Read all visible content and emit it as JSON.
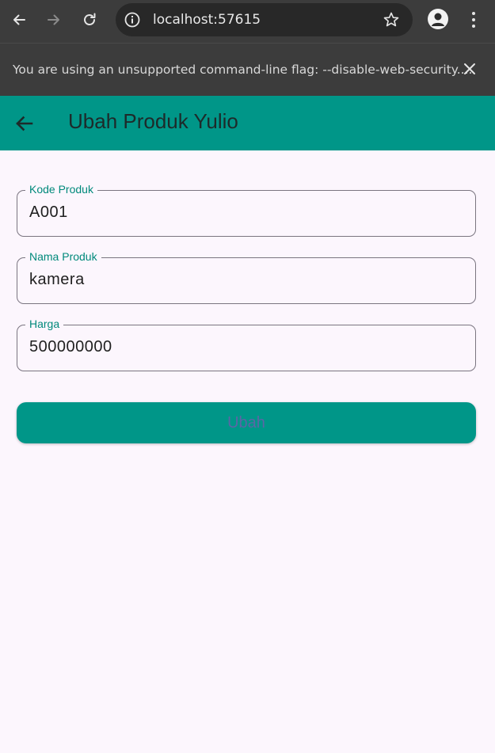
{
  "browser": {
    "url": "localhost:57615"
  },
  "infobar": {
    "message": "You are using an unsupported command-line flag: --disable-web-security...."
  },
  "appbar": {
    "title": "Ubah Produk Yulio"
  },
  "form": {
    "fields": [
      {
        "label": "Kode Produk",
        "value": "A001"
      },
      {
        "label": "Nama Produk",
        "value": "kamera"
      },
      {
        "label": "Harga",
        "value": "500000000"
      }
    ],
    "submit_label": "Ubah"
  },
  "colors": {
    "primary": "#009688",
    "background": "#fcf6fd",
    "label": "#00897b",
    "button_text": "#5a66a6"
  }
}
